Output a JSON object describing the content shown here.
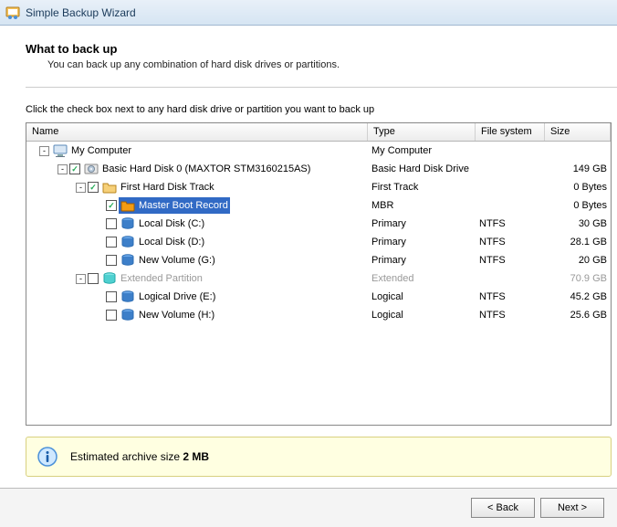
{
  "window": {
    "title": "Simple Backup Wizard"
  },
  "header": {
    "headline": "What to back up",
    "sub": "You can back up any combination of hard disk drives or partitions."
  },
  "instruction": "Click the check box next to any hard disk drive or partition you want to back up",
  "columns": {
    "name": "Name",
    "type": "Type",
    "fs": "File system",
    "size": "Size"
  },
  "tree": [
    {
      "indent": 0,
      "toggle": "-",
      "check": null,
      "icon": "computer",
      "label": "My Computer",
      "type": "My Computer",
      "fs": "",
      "size": ""
    },
    {
      "indent": 1,
      "toggle": "-",
      "check": "checked",
      "icon": "disk",
      "label": "Basic Hard Disk 0 (MAXTOR STM3160215AS)",
      "type": "Basic Hard Disk Drive",
      "fs": "",
      "size": "149 GB"
    },
    {
      "indent": 2,
      "toggle": "-",
      "check": "checked",
      "icon": "folder",
      "label": "First Hard Disk Track",
      "type": "First Track",
      "fs": "",
      "size": "0 Bytes"
    },
    {
      "indent": 3,
      "toggle": null,
      "check": "checked",
      "icon": "folder-orange",
      "label": "Master Boot Record",
      "type": "MBR",
      "fs": "",
      "size": "0 Bytes",
      "selected": true
    },
    {
      "indent": 3,
      "toggle": null,
      "check": "unchecked",
      "icon": "drive",
      "label": "Local Disk (C:)",
      "type": "Primary",
      "fs": "NTFS",
      "size": "30 GB"
    },
    {
      "indent": 3,
      "toggle": null,
      "check": "unchecked",
      "icon": "drive",
      "label": "Local Disk (D:)",
      "type": "Primary",
      "fs": "NTFS",
      "size": "28.1 GB"
    },
    {
      "indent": 3,
      "toggle": null,
      "check": "unchecked",
      "icon": "drive",
      "label": "New Volume (G:)",
      "type": "Primary",
      "fs": "NTFS",
      "size": "20 GB"
    },
    {
      "indent": 2,
      "toggle": "-",
      "check": "unchecked",
      "icon": "drive-cyan",
      "label": "Extended Partition",
      "type": "Extended",
      "fs": "",
      "size": "70.9 GB",
      "disabled": true
    },
    {
      "indent": 3,
      "toggle": null,
      "check": "unchecked",
      "icon": "drive",
      "label": "Logical Drive (E:)",
      "type": "Logical",
      "fs": "NTFS",
      "size": "45.2 GB"
    },
    {
      "indent": 3,
      "toggle": null,
      "check": "unchecked",
      "icon": "drive",
      "label": "New Volume (H:)",
      "type": "Logical",
      "fs": "NTFS",
      "size": "25.6 GB"
    }
  ],
  "estimate": {
    "prefix": "Estimated archive size ",
    "value": "2 MB"
  },
  "buttons": {
    "back": "< Back",
    "next": "Next >"
  }
}
